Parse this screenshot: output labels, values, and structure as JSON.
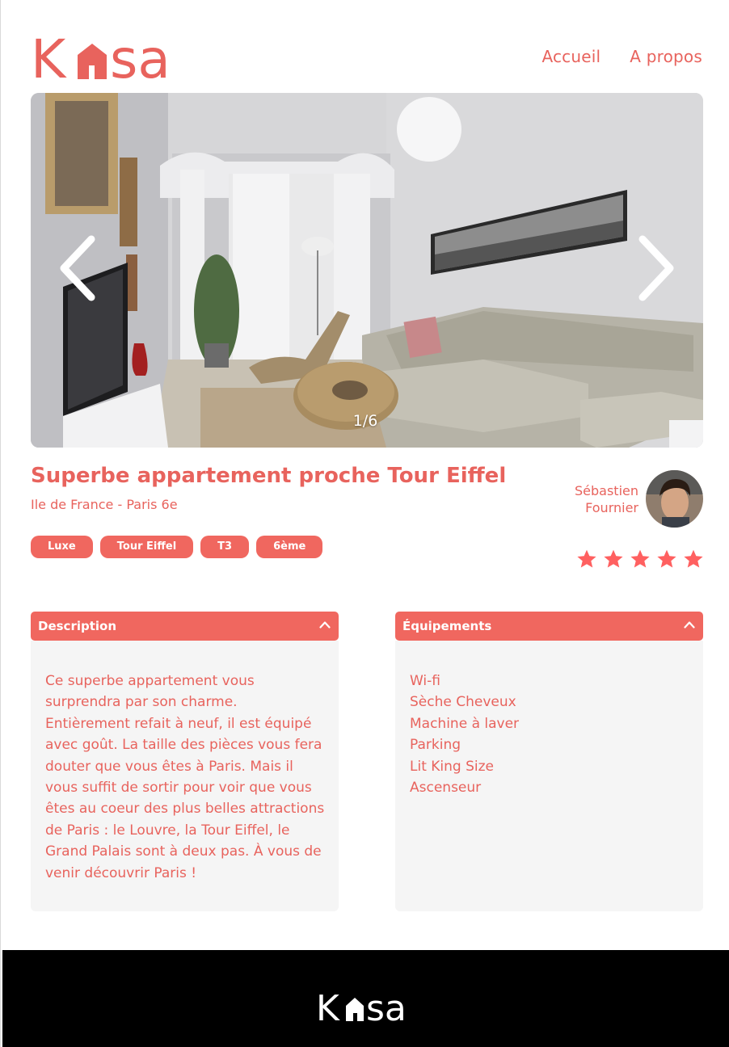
{
  "brand": {
    "logo_text_left": "K",
    "logo_text_right": "sa",
    "accent": "#f0675f",
    "text_accent": "#e8635d"
  },
  "nav": {
    "items": [
      {
        "label": "Accueil"
      },
      {
        "label": "A propos"
      }
    ]
  },
  "gallery": {
    "counter": "1/6",
    "prev_icon": "chevron-left-icon",
    "next_icon": "chevron-right-icon"
  },
  "listing": {
    "title": "Superbe appartement proche Tour Eiffel",
    "location": "Ile de France - Paris 6e",
    "tags": [
      "Luxe",
      "Tour Eiffel",
      "T3",
      "6ème"
    ],
    "host": {
      "first_name": "Sébastien",
      "last_name": "Fournier"
    },
    "rating": {
      "value": 5,
      "max": 5
    }
  },
  "description": {
    "heading": "Description",
    "text": "Ce superbe appartement vous surprendra par son charme. Entièrement refait à neuf, il est équipé avec goût. La taille des pièces vous fera douter que vous êtes à Paris. Mais il vous suffit de sortir pour voir que vous êtes au coeur des plus belles attractions de Paris : le Louvre, la Tour Eiffel, le Grand Palais sont à deux pas. À vous de venir découvrir Paris !"
  },
  "equipments": {
    "heading": "Équipements",
    "items": [
      "Wi-fi",
      "Sèche Cheveux",
      "Machine à laver",
      "Parking",
      "Lit King Size",
      "Ascenseur"
    ]
  },
  "footer": {
    "background": "#000000"
  }
}
